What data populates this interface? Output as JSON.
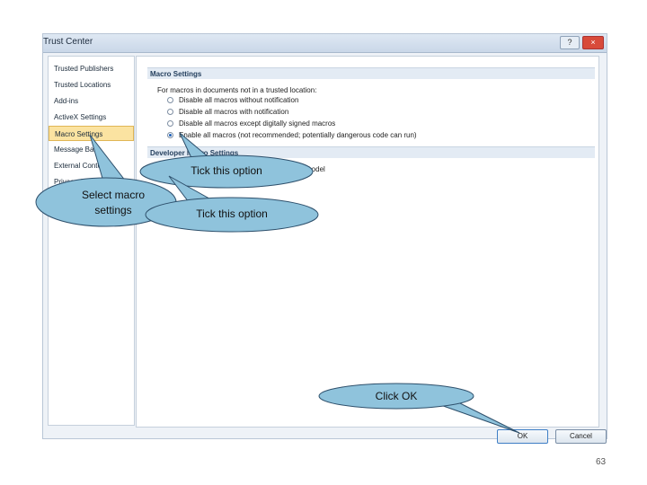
{
  "window": {
    "title": "Trust Center",
    "help_label": "?",
    "close_label": "×"
  },
  "sidebar": {
    "items": [
      {
        "label": "Trusted Publishers",
        "selected": false
      },
      {
        "label": "Trusted Locations",
        "selected": false
      },
      {
        "label": "Add-ins",
        "selected": false
      },
      {
        "label": "ActiveX Settings",
        "selected": false
      },
      {
        "label": "Macro Settings",
        "selected": true
      },
      {
        "label": "Message Bar",
        "selected": false
      },
      {
        "label": "External Content",
        "selected": false
      },
      {
        "label": "Privacy Options",
        "selected": false
      }
    ]
  },
  "macro": {
    "header": "Macro Settings",
    "intro": "For macros in documents not in a trusted location:",
    "options": [
      {
        "label": "Disable all macros without notification",
        "selected": false
      },
      {
        "label": "Disable all macros with notification",
        "selected": false
      },
      {
        "label": "Disable all macros except digitally signed macros",
        "selected": false
      },
      {
        "label": "Enable all macros (not recommended; potentially dangerous code can run)",
        "selected": true
      }
    ]
  },
  "developer": {
    "header": "Developer Macro Settings",
    "tail_text": "model"
  },
  "buttons": {
    "ok": "OK",
    "cancel": "Cancel"
  },
  "callouts": {
    "tick1": "Tick this option",
    "select": "Select macro settings",
    "tick2": "Tick this option",
    "ok": "Click OK"
  },
  "page_number": "63"
}
